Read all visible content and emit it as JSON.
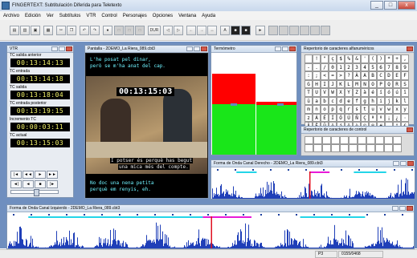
{
  "window": {
    "title": "FINGERTEXT: Subtitulación Diferida para Teletexto",
    "controls": [
      "_",
      "□",
      "x"
    ]
  },
  "menu": [
    "Archivo",
    "Edición",
    "Ver",
    "Subtítulos",
    "VTR",
    "Control",
    "Personajes",
    "Opciones",
    "Ventana",
    "Ayuda"
  ],
  "toolbar": {
    "dur_label": "DUR"
  },
  "vtr": {
    "title": "VTR",
    "fields": [
      {
        "label": "TC salida anterior",
        "value": "00:13:14:13"
      },
      {
        "label": "TC entrada",
        "value": "00:13:14:18"
      },
      {
        "label": "TC salida",
        "value": "00:13:18:04"
      },
      {
        "label": "TC entrada posterior",
        "value": "00:13:19:15"
      },
      {
        "label": "Incremento TC",
        "value": "00:00:03:11"
      },
      {
        "label": "TC actual",
        "value": "00:13:15:03"
      }
    ],
    "transport": [
      "|◄",
      "◄◄",
      "►",
      "►►",
      "◄|",
      "◄",
      "■",
      "|►"
    ]
  },
  "pantalla": {
    "title": "Pantalla - 2DEMO_La Riera_089.cbt3",
    "timecode": "00:13:15:03",
    "subtitles_top": [
      "L'he posat pel dinar,",
      "però se m'ha anat del cap."
    ],
    "subtitles_mid": [
      "I potser és perquè has begut",
      "una mica més del compte."
    ],
    "subtitles_bottom": [
      "No doc una nena petita",
      "perquè em renyis, eh."
    ]
  },
  "termometro": {
    "title": "Termómetro",
    "level_left": 0.55,
    "level_right": 0.47,
    "colors": {
      "red": "#ff0000",
      "green": "#19e619"
    }
  },
  "repertorio_alfa": {
    "title": "Repertorio de caracteres alfanuméricos",
    "chars": [
      "",
      "!",
      "\"",
      "ç",
      "$",
      "%",
      "&",
      "'",
      "(",
      ")",
      "*",
      "+",
      ",",
      "-",
      ".",
      "/",
      "0",
      "1",
      "2",
      "3",
      "4",
      "5",
      "6",
      "7",
      "8",
      "9",
      ":",
      ";",
      "<",
      "=",
      ">",
      "?",
      "À",
      "A",
      "B",
      "C",
      "D",
      "E",
      "F",
      "G",
      "H",
      "I",
      "J",
      "K",
      "L",
      "M",
      "N",
      "O",
      "P",
      "Q",
      "R",
      "S",
      "T",
      "U",
      "V",
      "W",
      "X",
      "Y",
      "Z",
      "à",
      "é",
      "í",
      "ó",
      "ú",
      "ï",
      "ü",
      "a",
      "b",
      "c",
      "d",
      "e",
      "f",
      "g",
      "h",
      "i",
      "j",
      "k",
      "l",
      "m",
      "n",
      "o",
      "p",
      "q",
      "r",
      "s",
      "t",
      "u",
      "v",
      "w",
      "x",
      "y",
      "z",
      "Á",
      "É",
      "Í",
      "Ó",
      "Ú",
      "Ñ",
      "Ç",
      "ª",
      "º",
      "¡",
      "¿",
      "·",
      "Ä",
      "Ë",
      "Ü",
      "ö",
      "á",
      "ê",
      "è",
      "©",
      "®",
      "#",
      "—",
      "°",
      "€"
    ]
  },
  "repertorio_ctrl": {
    "title": "Repertorio de caracteres de control",
    "row1": [
      "",
      "",
      "",
      "",
      "",
      "",
      "",
      "",
      "",
      "",
      ""
    ],
    "row2": [
      "",
      "",
      "",
      "",
      "",
      "",
      "",
      "",
      "",
      "",
      ""
    ]
  },
  "wave_right": {
    "title": "Forma de Onda Canal Derecho - 2DEMO_La Riera_089.cbt3"
  },
  "wave_left": {
    "title": "Forma de Onda Canal Izquierdo - 2DEMO_La Riera_089.cbt3"
  },
  "status": {
    "mode": "P3",
    "counter": "0155/0468"
  }
}
